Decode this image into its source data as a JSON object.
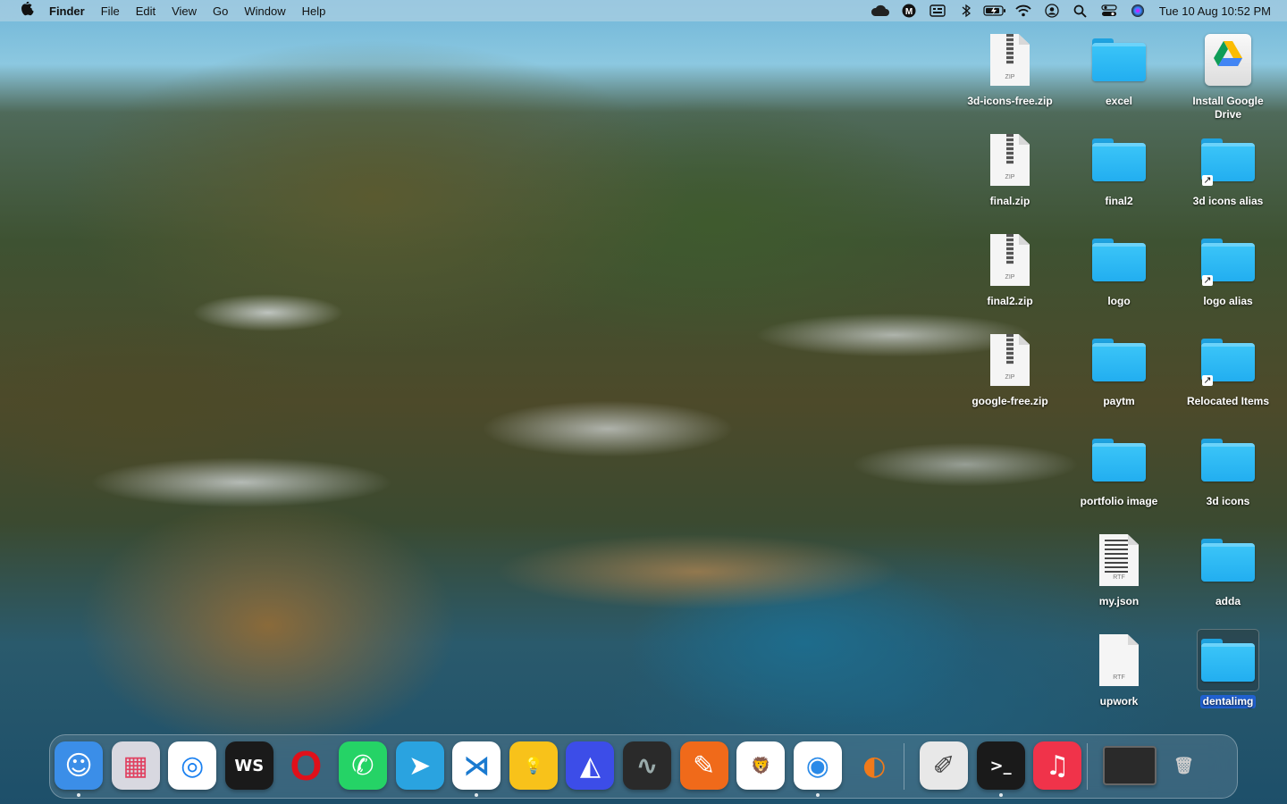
{
  "menubar": {
    "app_name": "Finder",
    "menus": [
      "File",
      "Edit",
      "View",
      "Go",
      "Window",
      "Help"
    ],
    "clock": "Tue 10 Aug  10:52 PM",
    "status_icons": [
      "cloud-icon",
      "m-icon",
      "keyboard-icon",
      "bluetooth-icon",
      "battery-icon",
      "wifi-icon",
      "user-icon",
      "search-icon",
      "control-center-icon",
      "siri-icon"
    ]
  },
  "desktop": {
    "zip_files": [
      {
        "label": "3d-icons-free.zip",
        "kind": "ZIP"
      },
      {
        "label": "final.zip",
        "kind": "ZIP"
      },
      {
        "label": "final2.zip",
        "kind": "ZIP"
      },
      {
        "label": "google-free.zip",
        "kind": "ZIP"
      }
    ],
    "middle_items": [
      {
        "label": "excel",
        "type": "folder"
      },
      {
        "label": "final2",
        "type": "folder"
      },
      {
        "label": "logo",
        "type": "folder"
      },
      {
        "label": "paytm",
        "type": "folder"
      },
      {
        "label": "portfolio image",
        "type": "folder"
      },
      {
        "label": "my.json",
        "type": "rtf",
        "kind": "RTF"
      },
      {
        "label": "upwork",
        "type": "rtf",
        "kind": "RTF"
      }
    ],
    "right_items": [
      {
        "label": "Install Google Drive",
        "type": "app"
      },
      {
        "label": "3d icons alias",
        "type": "alias"
      },
      {
        "label": "logo alias",
        "type": "alias"
      },
      {
        "label": "Relocated Items",
        "type": "alias"
      },
      {
        "label": "3d icons",
        "type": "folder"
      },
      {
        "label": "adda",
        "type": "folder"
      },
      {
        "label": "dentalimg",
        "type": "folder",
        "selected": true
      }
    ]
  },
  "dock": {
    "apps": [
      {
        "name": "finder-icon",
        "glyph": "☺",
        "bg": "#3b8ee8",
        "fg": "#fff",
        "running": true
      },
      {
        "name": "launchpad-icon",
        "glyph": "▦",
        "bg": "#d8d8e0",
        "fg": "#e04060",
        "running": false
      },
      {
        "name": "safari-icon",
        "glyph": "◎",
        "bg": "#ffffff",
        "fg": "#1a80f0",
        "running": false
      },
      {
        "name": "webstorm-icon",
        "glyph": "WS",
        "bg": "#1a1a1a",
        "fg": "#ffffff",
        "running": false
      },
      {
        "name": "opera-icon",
        "glyph": "O",
        "bg": "transparent",
        "fg": "#e0101a",
        "running": false
      },
      {
        "name": "whatsapp-icon",
        "glyph": "✆",
        "bg": "#25d366",
        "fg": "#ffffff",
        "running": false
      },
      {
        "name": "telegram-icon",
        "glyph": "➤",
        "bg": "#2aa3e0",
        "fg": "#ffffff",
        "running": false
      },
      {
        "name": "vscode-icon",
        "glyph": "⋊",
        "bg": "#ffffff",
        "fg": "#1a7ad0",
        "running": true
      },
      {
        "name": "keep-icon",
        "glyph": "💡",
        "bg": "#f8c21a",
        "fg": "#ffffff",
        "running": false
      },
      {
        "name": "app-icon",
        "glyph": "◭",
        "bg": "#3c4de8",
        "fg": "#ffffff",
        "running": false
      },
      {
        "name": "activity-monitor-icon",
        "glyph": "∿",
        "bg": "#2a2a2a",
        "fg": "#9aa",
        "running": false
      },
      {
        "name": "pen-app-icon",
        "glyph": "✎",
        "bg": "#f06a1a",
        "fg": "#ffffff",
        "running": false
      },
      {
        "name": "brave-icon",
        "glyph": "🦁",
        "bg": "#ffffff",
        "fg": "#f04a1a",
        "running": false
      },
      {
        "name": "chrome-icon",
        "glyph": "◉",
        "bg": "#ffffff",
        "fg": "#2a8ae8",
        "running": true
      },
      {
        "name": "firefox-icon",
        "glyph": "◐",
        "bg": "transparent",
        "fg": "#f07a1a",
        "running": false
      },
      {
        "name": "script-editor-icon",
        "glyph": "✐",
        "bg": "#e8e8e8",
        "fg": "#444",
        "running": false
      },
      {
        "name": "terminal-icon",
        "glyph": ">_",
        "bg": "#1a1a1a",
        "fg": "#ffffff",
        "running": true
      },
      {
        "name": "music-icon",
        "glyph": "♫",
        "bg": "#f0334a",
        "fg": "#ffffff",
        "running": false
      },
      {
        "name": "minimized-window-icon",
        "glyph": "",
        "bg": "#2a2a2a",
        "fg": "#fff",
        "running": false
      },
      {
        "name": "trash-icon",
        "glyph": "🗑",
        "bg": "transparent",
        "fg": "#ccc",
        "running": false
      }
    ]
  }
}
